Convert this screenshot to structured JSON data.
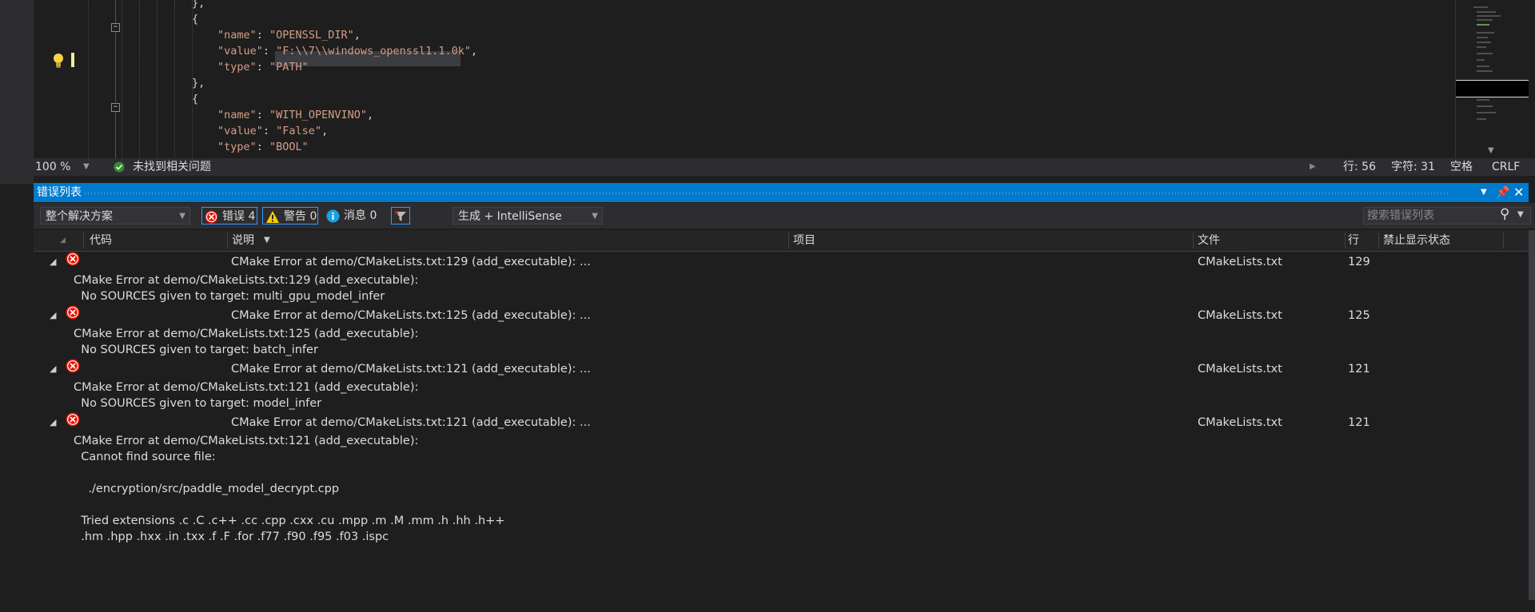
{
  "editor": {
    "code_lines": [
      {
        "parts": [
          [
            "p",
            "}"
          ],
          [
            "p",
            ","
          ]
        ]
      },
      {
        "parts": [
          [
            "p",
            "{"
          ]
        ]
      },
      {
        "parts": [
          [
            "k",
            "\"name\""
          ],
          [
            "p",
            ": "
          ],
          [
            "k",
            "\"OPENSSL_DIR\""
          ],
          [
            "p",
            ","
          ]
        ]
      },
      {
        "parts": [
          [
            "k",
            "\"value\""
          ],
          [
            "p",
            ": "
          ],
          [
            "k",
            "\"F:\\\\7\\\\windows_openssl1.1.0k\""
          ],
          [
            "p",
            ","
          ]
        ]
      },
      {
        "parts": [
          [
            "k",
            "\"type\""
          ],
          [
            "p",
            ": "
          ],
          [
            "k",
            "\"PATH\""
          ]
        ]
      },
      {
        "parts": [
          [
            "p",
            "}"
          ],
          [
            "p",
            ","
          ]
        ]
      },
      {
        "parts": [
          [
            "p",
            "{"
          ]
        ]
      },
      {
        "parts": [
          [
            "k",
            "\"name\""
          ],
          [
            "p",
            ": "
          ],
          [
            "k",
            "\"WITH_OPENVINO\""
          ],
          [
            "p",
            ","
          ]
        ]
      },
      {
        "parts": [
          [
            "k",
            "\"value\""
          ],
          [
            "p",
            ": "
          ],
          [
            "k",
            "\"False\""
          ],
          [
            "p",
            ","
          ]
        ]
      },
      {
        "parts": [
          [
            "k",
            "\"type\""
          ],
          [
            "p",
            ": "
          ],
          [
            "k",
            "\"BOOL\""
          ]
        ]
      }
    ],
    "status": {
      "zoom": "100 %",
      "issues_text": "未找到相关问题",
      "line": "行: 56",
      "char": "字符: 31",
      "indent": "空格",
      "eol": "CRLF"
    }
  },
  "panel": {
    "title": "错误列表",
    "scope": "整个解决方案",
    "errors_label": "错误 4",
    "warnings_label": "警告 0",
    "messages_label": "消息 0",
    "source_filter": "生成 + IntelliSense",
    "search_placeholder": "搜索错误列表"
  },
  "columns": {
    "code": "代码",
    "description": "说明",
    "project": "项目",
    "file": "文件",
    "line": "行",
    "suppression": "禁止显示状态"
  },
  "errors": [
    {
      "summary": "CMake Error at demo/CMakeLists.txt:129 (add_executable): ...",
      "file": "CMakeLists.txt",
      "line": "129",
      "detail": "CMake Error at demo/CMakeLists.txt:129 (add_executable):\n  No SOURCES given to target: multi_gpu_model_infer"
    },
    {
      "summary": "CMake Error at demo/CMakeLists.txt:125 (add_executable): ...",
      "file": "CMakeLists.txt",
      "line": "125",
      "detail": "CMake Error at demo/CMakeLists.txt:125 (add_executable):\n  No SOURCES given to target: batch_infer"
    },
    {
      "summary": "CMake Error at demo/CMakeLists.txt:121 (add_executable): ...",
      "file": "CMakeLists.txt",
      "line": "121",
      "detail": "CMake Error at demo/CMakeLists.txt:121 (add_executable):\n  No SOURCES given to target: model_infer"
    },
    {
      "summary": "CMake Error at demo/CMakeLists.txt:121 (add_executable): ...",
      "file": "CMakeLists.txt",
      "line": "121",
      "detail": "CMake Error at demo/CMakeLists.txt:121 (add_executable):\n  Cannot find source file:\n\n    ./encryption/src/paddle_model_decrypt.cpp\n\n  Tried extensions .c .C .c++ .cc .cpp .cxx .cu .mpp .m .M .mm .h .hh .h++\n  .hm .hpp .hxx .in .txx .f .F .for .f77 .f90 .f95 .f03 .ispc"
    }
  ],
  "colors": {
    "accent": "#007acc",
    "error": "#e51400",
    "warning": "#ffcc00",
    "info": "#1ba1e2",
    "string": "#d69d85"
  }
}
